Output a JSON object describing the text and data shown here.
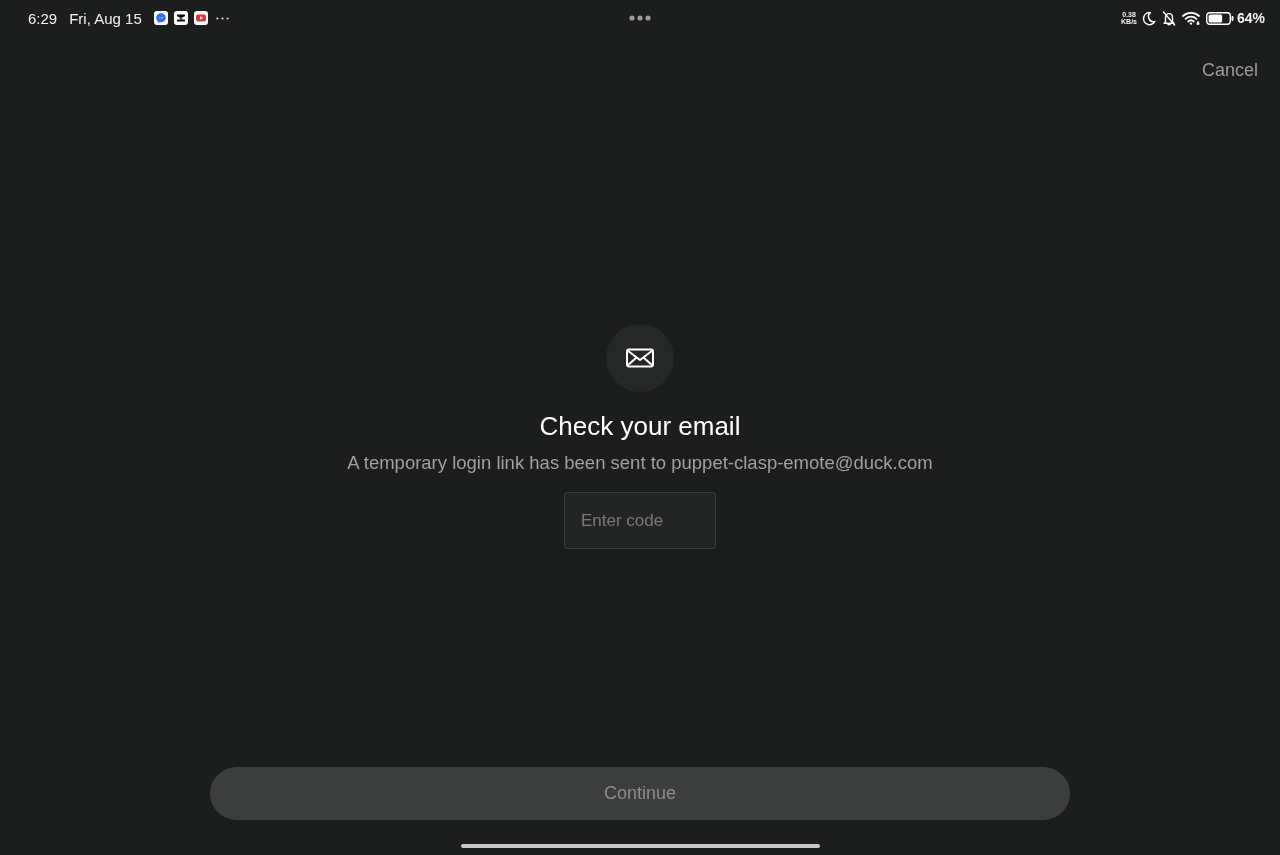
{
  "status_bar": {
    "time": "6:29",
    "date": "Fri, Aug 15",
    "network_speed": {
      "value": "0.38",
      "unit": "KB/s"
    },
    "battery": "64%"
  },
  "header": {
    "cancel": "Cancel"
  },
  "verify": {
    "title": "Check your email",
    "message": "A temporary login link has been sent to puppet-clasp-emote@duck.com",
    "code_field": {
      "placeholder": "Enter code"
    }
  },
  "continue_button": {
    "label": "Continue",
    "disabled": true
  }
}
